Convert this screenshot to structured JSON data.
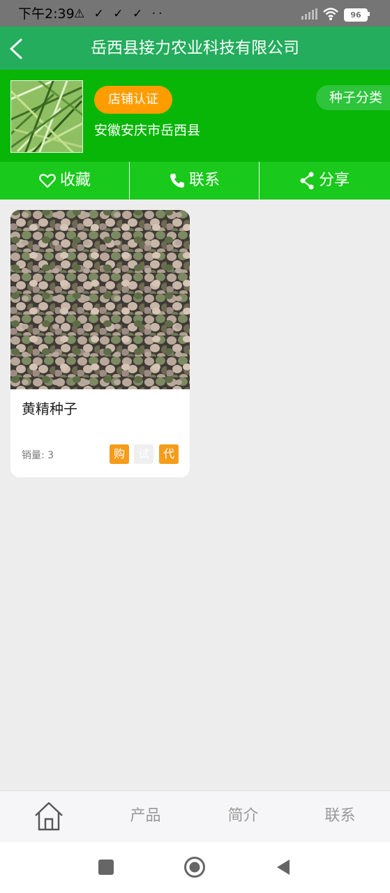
{
  "status_bar": {
    "time": "下午2:39",
    "left_icons": "⚠ ✓ ✓ ✓ ··",
    "battery": "96"
  },
  "header": {
    "title": "岳西县接力农业科技有限公司",
    "back_icon": "chevron-left-icon"
  },
  "shop": {
    "cert_label": "店铺认证",
    "location": "安徽安庆市岳西县",
    "category_label": "种子分类"
  },
  "actions": [
    {
      "label": "收藏",
      "icon": "heart-icon"
    },
    {
      "label": "联系",
      "icon": "phone-icon"
    },
    {
      "label": "分享",
      "icon": "share-icon"
    }
  ],
  "products": [
    {
      "title": "黄精种子",
      "sales": "销量: 3",
      "tags": [
        {
          "label": "购",
          "color": "#f59c1a"
        },
        {
          "label": "试",
          "color": "#efefef"
        },
        {
          "label": "代",
          "color": "#f59c1a"
        }
      ]
    }
  ],
  "bottom_nav": [
    {
      "label": "",
      "icon": "home-icon"
    },
    {
      "label": "产品"
    },
    {
      "label": "简介"
    },
    {
      "label": "联系"
    }
  ],
  "colors": {
    "header": "#23ad5c",
    "shop_band": "#08b607",
    "action_bar": "#19c91b",
    "badge": "#ff9d00"
  }
}
